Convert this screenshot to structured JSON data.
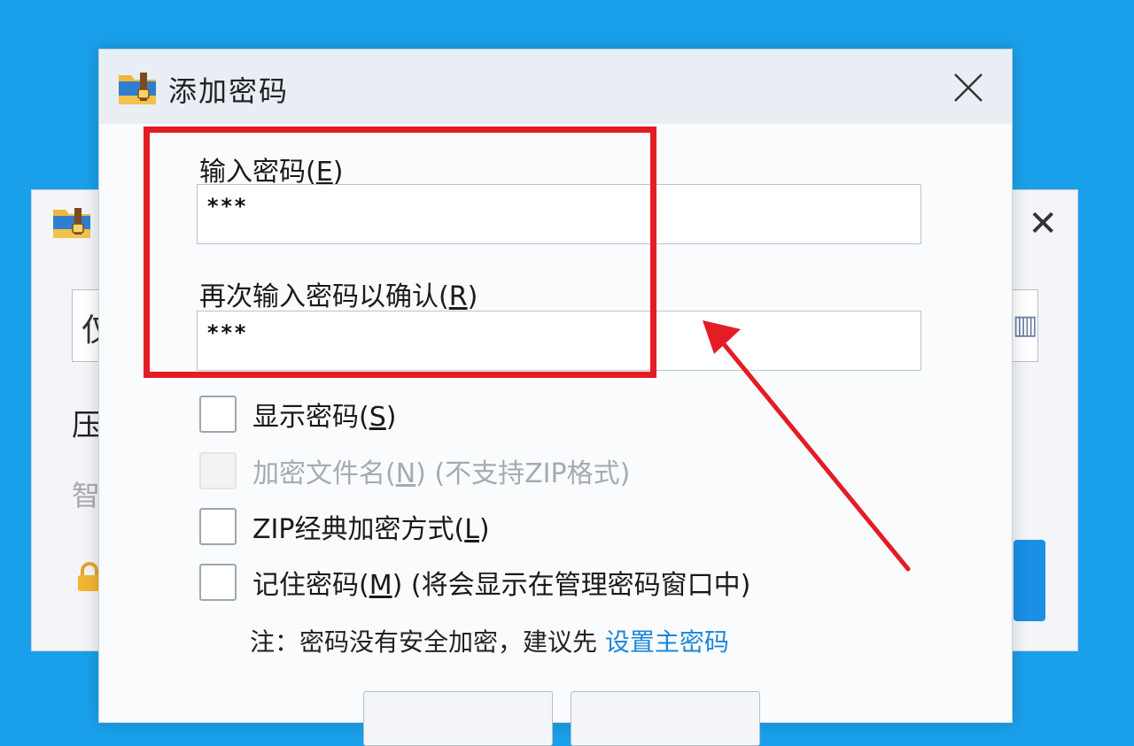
{
  "background_window": {
    "input_partial_text": "仅",
    "label_partial_1": "压",
    "label_partial_2": "智"
  },
  "dialog": {
    "title": "添加密码",
    "password_label_main": "输入密码(",
    "password_label_key": "E",
    "password_label_end": ")",
    "password_value": "***",
    "confirm_label_main": "再次输入密码以确认(",
    "confirm_label_key": "R",
    "confirm_label_end": ")",
    "confirm_value": "***",
    "options": [
      {
        "main": "显示密码(",
        "key": "S",
        "end": ")",
        "suffix": "",
        "disabled": false
      },
      {
        "main": "加密文件名(",
        "key": "N",
        "end": ")",
        "suffix": " (不支持ZIP格式)",
        "disabled": true
      },
      {
        "main": "ZIP经典加密方式(",
        "key": "L",
        "end": ")",
        "suffix": "",
        "disabled": false
      },
      {
        "main": "记住密码(",
        "key": "M",
        "end": ")",
        "suffix": " (将会显示在管理密码窗口中)",
        "disabled": false
      }
    ],
    "note_text": "注：密码没有安全加密，建议先 ",
    "note_link": "设置主密码"
  },
  "colors": {
    "desktop": "#1aa0ea",
    "highlight": "#e31c25",
    "link": "#1c87d8"
  },
  "icons": [
    "folder-zip-icon",
    "close-icon",
    "lock-icon"
  ]
}
